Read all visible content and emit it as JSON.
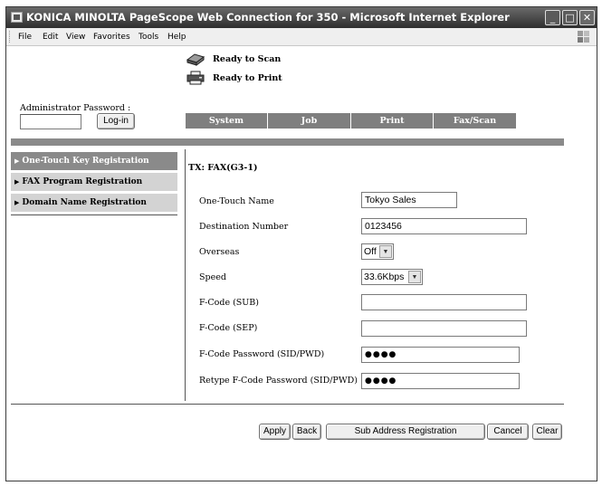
{
  "window": {
    "title": "KONICA MINOLTA PageScope Web Connection for 350 - Microsoft Internet Explorer",
    "controls": {
      "minimize": "_",
      "maximize": "□",
      "close": "✕"
    }
  },
  "menu": [
    "File",
    "Edit",
    "View",
    "Favorites",
    "Tools",
    "Help"
  ],
  "status": {
    "scan": {
      "text": "Ready to Scan",
      "icon": "scanner-icon"
    },
    "print": {
      "text": "Ready to Print",
      "icon": "printer-icon"
    }
  },
  "admin": {
    "label": "Administrator Password :",
    "value": "",
    "login_label": "Log-in"
  },
  "tabs": [
    "System",
    "Job",
    "Print",
    "Fax/Scan"
  ],
  "sidebar": {
    "items": [
      {
        "label": "One-Touch Key Registration",
        "active": true
      },
      {
        "label": "FAX Program Registration",
        "active": false
      },
      {
        "label": "Domain Name Registration",
        "active": false
      }
    ]
  },
  "form": {
    "title": "TX: FAX(G3-1)",
    "one_touch_name": {
      "label": "One-Touch Name",
      "value": "Tokyo Sales"
    },
    "destination_number": {
      "label": "Destination Number",
      "value": "0123456"
    },
    "overseas": {
      "label": "Overseas",
      "value": "Off"
    },
    "speed": {
      "label": "Speed",
      "value": "33.6Kbps"
    },
    "fcode_sub": {
      "label": "F-Code (SUB)",
      "value": ""
    },
    "fcode_sep": {
      "label": "F-Code (SEP)",
      "value": ""
    },
    "fcode_password": {
      "label": "F-Code Password (SID/PWD)",
      "value": "●●●●"
    },
    "retype_password": {
      "label": "Retype F-Code Password (SID/PWD)",
      "value": "●●●●"
    }
  },
  "actions": {
    "apply": "Apply",
    "back": "Back",
    "sub_address": "Sub Address Registration",
    "cancel": "Cancel",
    "clear": "Clear"
  },
  "colors": {
    "tab_bg": "#7f7f7f",
    "nav_active_bg": "#8a8a8a",
    "nav_bg": "#d3d3d3",
    "divider": "#8a8a8a"
  }
}
